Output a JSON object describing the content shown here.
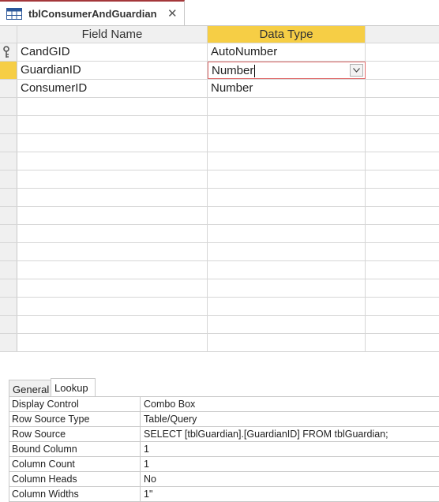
{
  "tab": {
    "title": "tblConsumerAndGuardian",
    "icon": "table-icon",
    "close_icon": "close-icon"
  },
  "grid": {
    "headers": {
      "field_name": "Field Name",
      "data_type": "Data Type"
    },
    "rows": [
      {
        "field": "CandGID",
        "type": "AutoNumber",
        "primary_key": true
      },
      {
        "field": "GuardianID",
        "type": "Number",
        "current": true
      },
      {
        "field": "ConsumerID",
        "type": "Number"
      }
    ],
    "accent_color": "#f6ce45"
  },
  "properties": {
    "tabs": {
      "general": "General",
      "lookup": "Lookup"
    },
    "active_tab": "Lookup",
    "rows": [
      {
        "name": "Display Control",
        "value": "Combo Box"
      },
      {
        "name": "Row Source Type",
        "value": "Table/Query"
      },
      {
        "name": "Row Source",
        "value": "SELECT [tblGuardian].[GuardianID] FROM tblGuardian;"
      },
      {
        "name": "Bound Column",
        "value": "1"
      },
      {
        "name": "Column Count",
        "value": "1"
      },
      {
        "name": "Column Heads",
        "value": "No"
      },
      {
        "name": "Column Widths",
        "value": "1\""
      }
    ]
  }
}
